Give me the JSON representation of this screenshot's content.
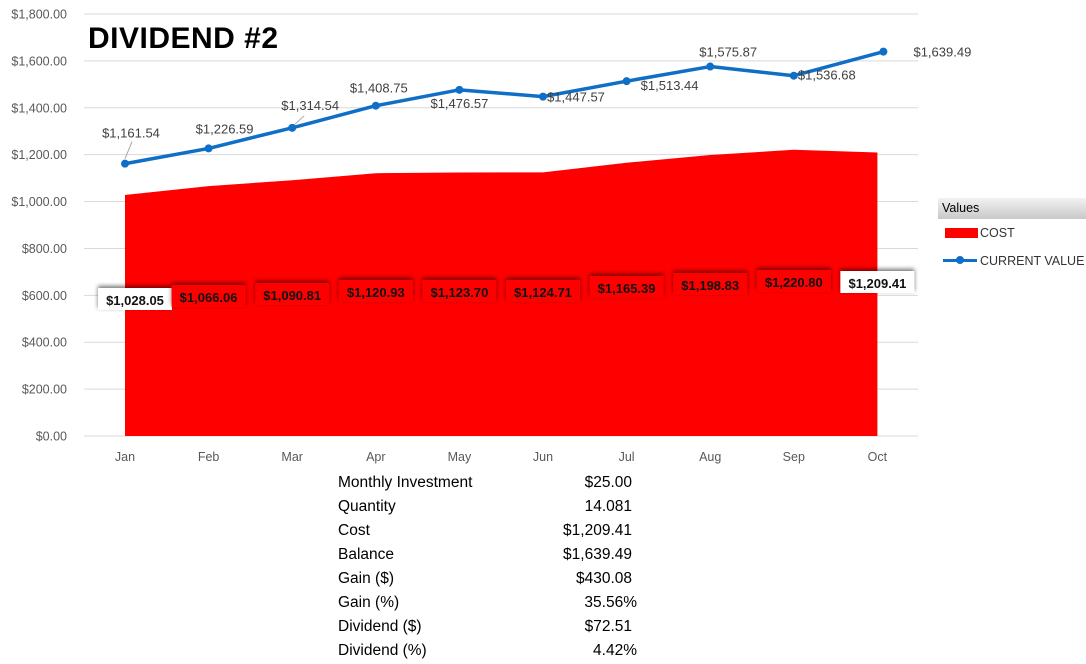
{
  "chart_data": {
    "type": "area+line",
    "title": "DIVIDEND #2",
    "categories": [
      "Jan",
      "Feb",
      "Mar",
      "Apr",
      "May",
      "Jun",
      "Jul",
      "Aug",
      "Sep",
      "Oct"
    ],
    "ylim": [
      0,
      1800
    ],
    "yticks": [
      "$0.00",
      "$200.00",
      "$400.00",
      "$600.00",
      "$800.00",
      "$1,000.00",
      "$1,200.00",
      "$1,400.00",
      "$1,600.00",
      "$1,800.00"
    ],
    "grid": true,
    "legend_title": "Values",
    "legend_position": "right",
    "series": [
      {
        "name": "COST",
        "type": "area",
        "color": "#ff0000",
        "values": [
          1028.05,
          1066.06,
          1090.81,
          1120.93,
          1123.7,
          1124.71,
          1165.39,
          1198.83,
          1220.8,
          1209.41
        ],
        "labels": [
          "$1,028.05",
          "$1,066.06",
          "$1,090.81",
          "$1,120.93",
          "$1,123.70",
          "$1,124.71",
          "$1,165.39",
          "$1,198.83",
          "$1,220.80",
          "$1,209.41"
        ]
      },
      {
        "name": "CURRENT VALUE",
        "type": "line",
        "color": "#0f6fc6",
        "values": [
          1161.54,
          1226.59,
          1314.54,
          1408.75,
          1476.57,
          1447.57,
          1513.44,
          1575.87,
          1536.68,
          1639.49
        ],
        "labels": [
          "$1,161.54",
          "$1,226.59",
          "$1,314.54",
          "$1,408.75",
          "$1,476.57",
          "$1,447.57",
          "$1,513.44",
          "$1,575.87",
          "$1,536.68",
          "$1,639.49"
        ]
      }
    ]
  },
  "summary": [
    {
      "key": "Monthly Investment",
      "value": "$25.00"
    },
    {
      "key": "Quantity",
      "value": "14.081"
    },
    {
      "key": "Cost",
      "value": "$1,209.41"
    },
    {
      "key": "Balance",
      "value": "$1,639.49"
    },
    {
      "key": "Gain ($)",
      "value": "$430.08"
    },
    {
      "key": "Gain (%)",
      "value": "35.56%"
    },
    {
      "key": "Dividend ($)",
      "value": "$72.51"
    },
    {
      "key": "Dividend (%)",
      "value": "4.42%"
    }
  ]
}
